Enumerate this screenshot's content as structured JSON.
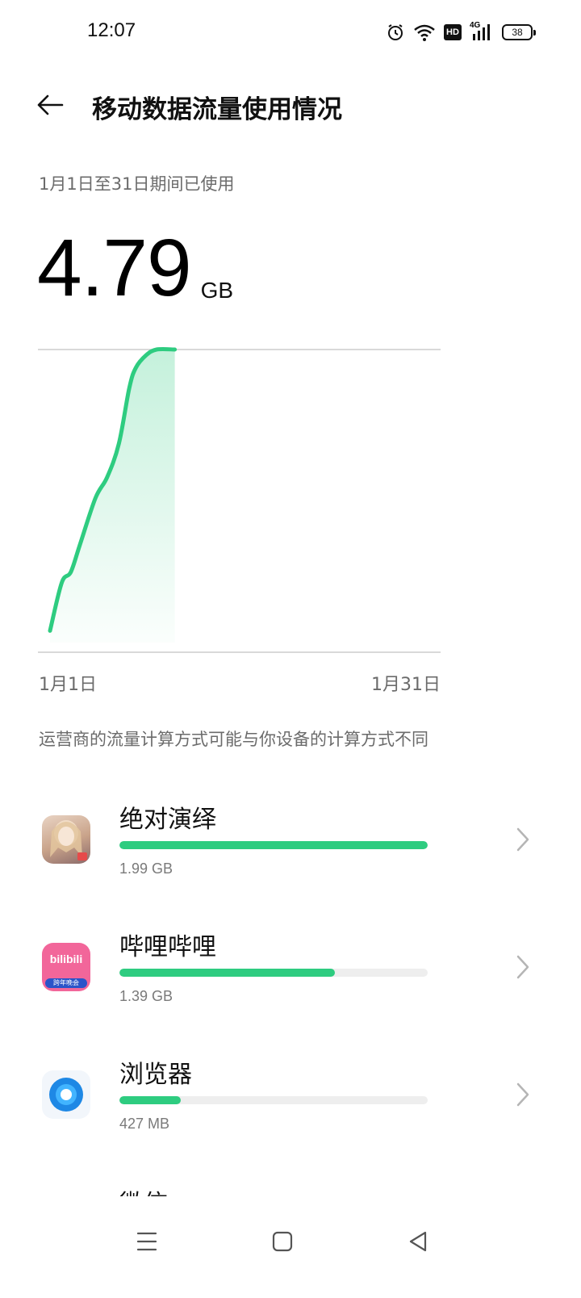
{
  "status_bar": {
    "time": "12:07",
    "network": "4G",
    "hd": "HD",
    "battery": "38",
    "icons": [
      "alarm-icon",
      "wifi-icon",
      "hd-icon",
      "signal-4g-icon",
      "battery-icon"
    ]
  },
  "header": {
    "back_icon": "arrow-left-icon",
    "title": "移动数据流量使用情况"
  },
  "summary": {
    "period": "1月1日至31日期间已使用",
    "value": "4.79",
    "unit": "GB"
  },
  "chart_data": {
    "type": "area",
    "x_start_label": "1月1日",
    "x_end_label": "1月31日",
    "xlim": [
      1,
      31
    ],
    "ylim": [
      0,
      4.79
    ],
    "x": [
      1,
      1.9,
      2.6,
      3.3,
      4.5,
      5.4,
      6.3,
      7.1,
      7.6,
      8.4,
      9.2,
      10.6
    ],
    "values": [
      0.34,
      1.1,
      1.27,
      1.7,
      2.44,
      2.77,
      3.3,
      4.18,
      4.5,
      4.7,
      4.79,
      4.79
    ],
    "color": "#2ecc80",
    "grid": true
  },
  "note": "运营商的流量计算方式可能与你设备的计算方式不同",
  "apps": [
    {
      "name": "绝对演绎",
      "size": "1.99 GB",
      "fraction": 1.0,
      "icon": "app-icon-juedui"
    },
    {
      "name": "哔哩哔哩",
      "size": "1.39 GB",
      "fraction": 0.698,
      "icon": "bilibili-icon",
      "icon_text": "bilibili",
      "icon_badge": "跨年晚会"
    },
    {
      "name": "浏览器",
      "size": "427 MB",
      "fraction": 0.2,
      "icon": "browser-icon"
    }
  ],
  "partial_app": "微信",
  "nav": {
    "icons": [
      "menu-icon",
      "home-icon",
      "back-triangle-icon"
    ]
  },
  "colors": {
    "accent": "#2ecc80",
    "track": "#eeeeee",
    "secondary_text": "#6b6b6b"
  }
}
